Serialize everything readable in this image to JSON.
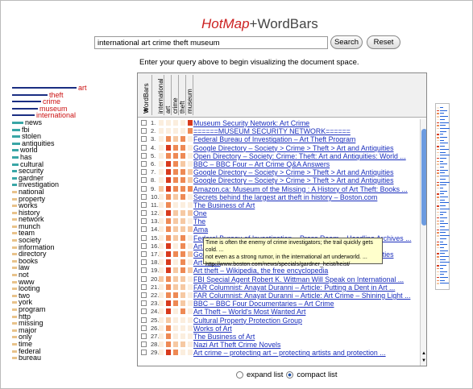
{
  "app": {
    "logo_hot": "HotMap",
    "logo_plus": "+",
    "logo_wb": "WordBars"
  },
  "search": {
    "value": "international art crime theft museum",
    "search_label": "Search",
    "reset_label": "Reset"
  },
  "hint": "Enter your query above to begin visualizing the document space.",
  "colors": {
    "bar": "#1a2e82",
    "red": "#cc1111",
    "teal": "#3aa6a6",
    "gray": "#9aa",
    "link": "#1a2ebd"
  },
  "wordbars": [
    {
      "term": "art",
      "level": 1.0,
      "color": "#cc1111"
    },
    {
      "term": "theft",
      "level": 0.55,
      "color": "#cc1111"
    },
    {
      "term": "crime",
      "level": 0.45,
      "color": "#cc1111"
    },
    {
      "term": "museum",
      "level": 0.4,
      "color": "#cc1111"
    },
    {
      "term": "international",
      "level": 0.35,
      "color": "#cc1111"
    },
    {
      "term": "news",
      "level": 0.18,
      "color": "#000"
    },
    {
      "term": "fbi",
      "level": 0.12,
      "color": "#000"
    },
    {
      "term": "stolen",
      "level": 0.12,
      "color": "#000"
    },
    {
      "term": "antiquities",
      "level": 0.12,
      "color": "#000"
    },
    {
      "term": "world",
      "level": 0.1,
      "color": "#000"
    },
    {
      "term": "has",
      "level": 0.1,
      "color": "#000"
    },
    {
      "term": "cultural",
      "level": 0.1,
      "color": "#000"
    },
    {
      "term": "security",
      "level": 0.08,
      "color": "#000"
    },
    {
      "term": "gardner",
      "level": 0.07,
      "color": "#000"
    },
    {
      "term": "investigation",
      "level": 0.06,
      "color": "#000"
    },
    {
      "term": "national",
      "level": 0.06,
      "color": "#000"
    },
    {
      "term": "property",
      "level": 0.05,
      "color": "#000"
    },
    {
      "term": "works",
      "level": 0.05,
      "color": "#000"
    },
    {
      "term": "history",
      "level": 0.05,
      "color": "#000"
    },
    {
      "term": "network",
      "level": 0.05,
      "color": "#000"
    },
    {
      "term": "munch",
      "level": 0.04,
      "color": "#000"
    },
    {
      "term": "team",
      "level": 0.04,
      "color": "#000"
    },
    {
      "term": "society",
      "level": 0.03,
      "color": "#000"
    },
    {
      "term": "information",
      "level": 0.03,
      "color": "#000"
    },
    {
      "term": "directory",
      "level": 0.03,
      "color": "#000"
    },
    {
      "term": "books",
      "level": 0.03,
      "color": "#000"
    },
    {
      "term": "law",
      "level": 0.02,
      "color": "#000"
    },
    {
      "term": "not",
      "level": 0.02,
      "color": "#000"
    },
    {
      "term": "www",
      "level": 0.02,
      "color": "#000"
    },
    {
      "term": "looting",
      "level": 0.02,
      "color": "#000"
    },
    {
      "term": "two",
      "level": 0.02,
      "color": "#000"
    },
    {
      "term": "york",
      "level": 0.02,
      "color": "#000"
    },
    {
      "term": "program",
      "level": 0.02,
      "color": "#000"
    },
    {
      "term": "http",
      "level": 0.02,
      "color": "#000"
    },
    {
      "term": "missing",
      "level": 0.02,
      "color": "#000"
    },
    {
      "term": "major",
      "level": 0.02,
      "color": "#000"
    },
    {
      "term": "only",
      "level": 0.02,
      "color": "#000"
    },
    {
      "term": "time",
      "level": 0.02,
      "color": "#000"
    },
    {
      "term": "federal",
      "level": 0.02,
      "color": "#000"
    },
    {
      "term": "bureau",
      "level": 0.02,
      "color": "#000"
    }
  ],
  "columns": {
    "wordbars": "WordBars",
    "terms": [
      "international",
      "art",
      "crime",
      "theft",
      "museum"
    ]
  },
  "results": [
    {
      "n": "1.",
      "title": "Museum Security Network: Art Crime",
      "heat": [
        0,
        0,
        0,
        0,
        3
      ]
    },
    {
      "n": "2.",
      "title": "======MUSEUM SECURITY NETWORK======",
      "heat": [
        0,
        0,
        0,
        0,
        2
      ]
    },
    {
      "n": "3.",
      "title": "Federal Bureau of Investigation – Art Theft Program",
      "heat": [
        0,
        2,
        1,
        2,
        0
      ]
    },
    {
      "n": "4.",
      "title": "Google Directory – Society > Crime > Theft > Art and Antiquities",
      "heat": [
        0,
        3,
        2,
        2,
        0
      ]
    },
    {
      "n": "5.",
      "title": "Open Directory – Society: Crime: Theft: Art and Antiquities: World ...",
      "heat": [
        0,
        2,
        2,
        2,
        0
      ]
    },
    {
      "n": "6.",
      "title": "BBC – BBC Four – Art Crime Q&A Answers",
      "heat": [
        0,
        3,
        2,
        1,
        0
      ]
    },
    {
      "n": "7.",
      "title": "Google Directory – Society > Crime > Theft > Art and Antiquities",
      "heat": [
        0,
        3,
        2,
        2,
        1
      ]
    },
    {
      "n": "8.",
      "title": "Google Directory – Society > Crime > Theft > Art and Antiquities",
      "heat": [
        0,
        3,
        2,
        2,
        1
      ]
    },
    {
      "n": "9.",
      "title": "Amazon.ca: Museum of the Missing : A History of Art Theft: Books ...",
      "heat": [
        1,
        3,
        2,
        2,
        2
      ]
    },
    {
      "n": "10.",
      "title": "Secrets behind the largest art theft in history – Boston.com",
      "heat": [
        0,
        2,
        1,
        2,
        0
      ]
    },
    {
      "n": "11.",
      "title": "The Business of Art",
      "heat": [
        0,
        2,
        0,
        0,
        0
      ]
    },
    {
      "n": "12.",
      "title": "One",
      "heat": [
        0,
        3,
        1,
        1,
        1
      ]
    },
    {
      "n": "13.",
      "title": "The",
      "heat": [
        0,
        2,
        1,
        1,
        0
      ]
    },
    {
      "n": "14.",
      "title": "Ama",
      "heat": [
        0,
        2,
        1,
        1,
        1
      ]
    },
    {
      "n": "15.",
      "title": "Federal Bureau of Investigation – Press Room – Headline Archives ...",
      "heat": [
        0,
        2,
        1,
        2,
        0
      ]
    },
    {
      "n": "16.",
      "title": "Art Theft – World's Most Wanted Art",
      "heat": [
        0,
        3,
        0,
        2,
        0
      ]
    },
    {
      "n": "17.",
      "title": "Google Directory – Society > Crime > Theft > Art and Antiquities",
      "heat": [
        0,
        3,
        2,
        2,
        1
      ]
    },
    {
      "n": "18.",
      "title": "Art Theft",
      "heat": [
        0,
        3,
        0,
        2,
        0
      ]
    },
    {
      "n": "19.",
      "title": "Art theft – Wikipedia, the free encyclopedia",
      "heat": [
        0,
        3,
        1,
        2,
        1
      ]
    },
    {
      "n": "20.",
      "title": "FBI Special Agent Robert K. Wittman Will Speak on International ...",
      "heat": [
        1,
        2,
        1,
        1,
        0
      ]
    },
    {
      "n": "21.",
      "title": "FAR Columnist: Anayat Duranni – Article: Putting a Dent in Art ...",
      "heat": [
        0,
        2,
        1,
        1,
        0
      ]
    },
    {
      "n": "22.",
      "title": "FAR Columnist: Anayat Duranni – Article: Art Crime – Shining Light ...",
      "heat": [
        0,
        2,
        2,
        1,
        0
      ]
    },
    {
      "n": "23.",
      "title": "BBC – BBC Four Documentaries – Art Crime",
      "heat": [
        0,
        3,
        2,
        1,
        0
      ]
    },
    {
      "n": "24.",
      "title": "Art Theft – World's Most Wanted Art",
      "heat": [
        0,
        3,
        0,
        2,
        0
      ]
    },
    {
      "n": "25.",
      "title": "Cultural Property Protection Group",
      "heat": [
        0,
        1,
        0,
        0,
        0
      ]
    },
    {
      "n": "26.",
      "title": "Works of Art",
      "heat": [
        0,
        2,
        0,
        0,
        0
      ]
    },
    {
      "n": "27.",
      "title": "The Business of Art",
      "heat": [
        0,
        2,
        0,
        0,
        0
      ]
    },
    {
      "n": "28.",
      "title": "Nazi Art Theft Crime Novels",
      "heat": [
        0,
        2,
        1,
        1,
        0
      ]
    },
    {
      "n": "29.",
      "title": "Art crime – protecting art – protecting artists and protection ...",
      "heat": [
        0,
        3,
        2,
        0,
        0
      ]
    }
  ],
  "tooltip": {
    "line1": "Time is often the enemy of crime investigators; the trail quickly gets cold. ...",
    "line2": "not even as a strong rumor, in the international art underworld. ...",
    "url": "http://www.boston.com/news/specials/gardner_heist/heist/"
  },
  "view": {
    "expand_label": "expand list",
    "compact_label": "compact list",
    "selected": "compact"
  }
}
